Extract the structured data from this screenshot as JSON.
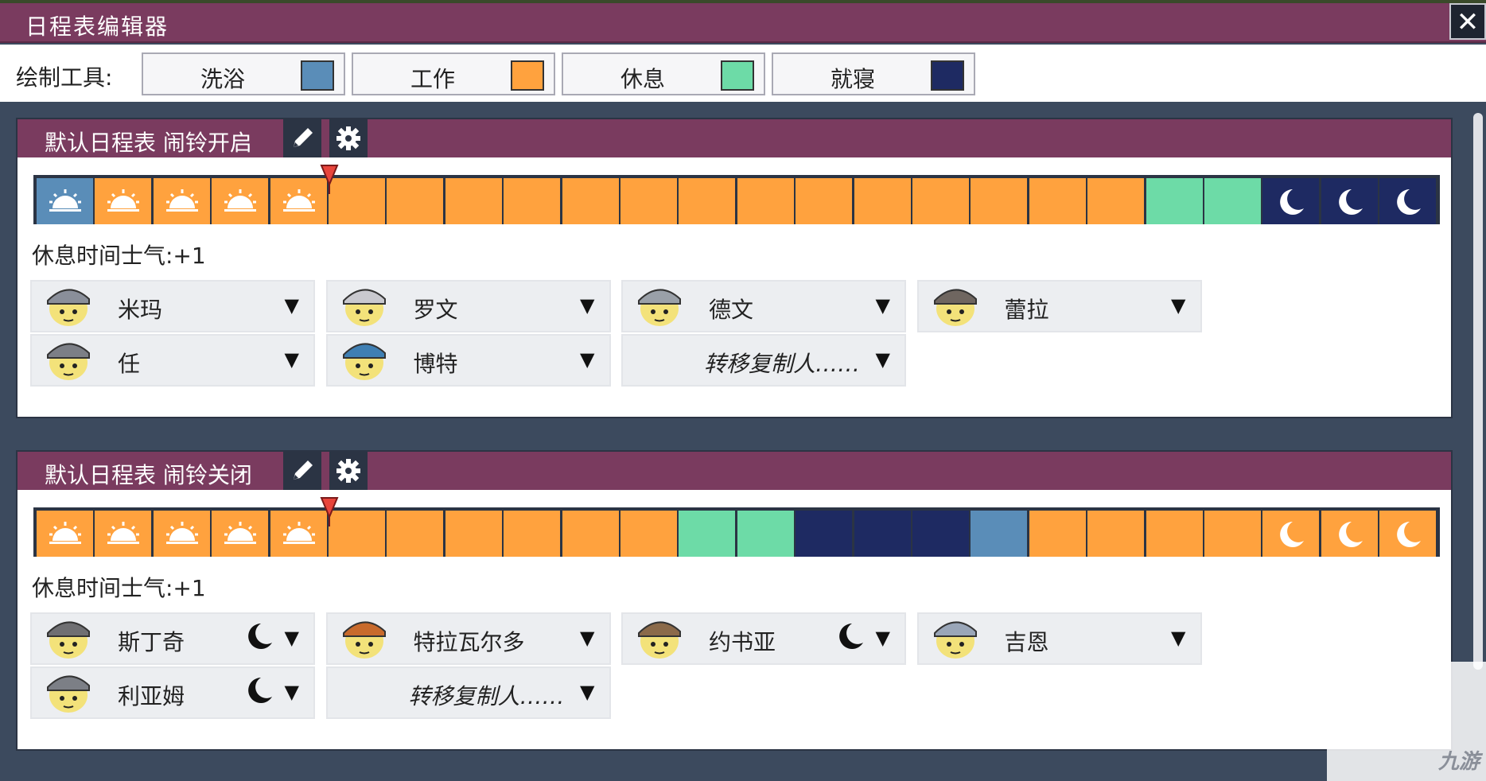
{
  "window": {
    "title": "日程表编辑器",
    "close": "✕"
  },
  "toolbar": {
    "label": "绘制工具:",
    "tools": [
      {
        "label": "洗浴",
        "color": "#5a8db8"
      },
      {
        "label": "工作",
        "color": "#ffa23e"
      },
      {
        "label": "休息",
        "color": "#6ddba7"
      },
      {
        "label": "就寝",
        "color": "#1e2a62"
      }
    ]
  },
  "schedules": [
    {
      "title": "默认日程表  闹铃开启",
      "edit_icon": "pencil-icon",
      "settings_icon": "gear-icon",
      "blocks": [
        "bath",
        "work",
        "work",
        "work",
        "work",
        "work",
        "work",
        "work",
        "work",
        "work",
        "work",
        "work",
        "work",
        "work",
        "work",
        "work",
        "work",
        "work",
        "work",
        "rest",
        "rest",
        "sleep",
        "sleep",
        "sleep"
      ],
      "block_icons": [
        "sun",
        "sun",
        "sun",
        "sun",
        "sun",
        "",
        "",
        "",
        "",
        "",
        "",
        "",
        "",
        "",
        "",
        "",
        "",
        "",
        "",
        "",
        "",
        "moon",
        "moon",
        "moon"
      ],
      "morale": "休息时间士气:+1",
      "dupes": [
        {
          "name": "米玛",
          "icon": "arrow-down",
          "moon": false
        },
        {
          "name": "罗文",
          "icon": "arrow-down",
          "moon": false
        },
        {
          "name": "德文",
          "icon": "arrow-down",
          "moon": false
        },
        {
          "name": "蕾拉",
          "icon": "arrow-down",
          "moon": false
        },
        {
          "name": "任",
          "icon": "arrow-down",
          "moon": false
        },
        {
          "name": "博特",
          "icon": "arrow-down",
          "moon": false
        }
      ],
      "transfer": "转移复制人……"
    },
    {
      "title": "默认日程表  闹铃关闭",
      "edit_icon": "pencil-icon",
      "settings_icon": "gear-icon",
      "blocks": [
        "work",
        "work",
        "work",
        "work",
        "work",
        "work",
        "work",
        "work",
        "work",
        "work",
        "work",
        "rest",
        "rest",
        "sleep",
        "sleep",
        "sleep",
        "bath",
        "work",
        "work",
        "work",
        "work",
        "work",
        "work",
        "work"
      ],
      "block_icons": [
        "sun",
        "sun",
        "sun",
        "sun",
        "sun",
        "",
        "",
        "",
        "",
        "",
        "",
        "",
        "",
        "",
        "",
        "",
        "",
        "",
        "",
        "",
        "",
        "moon",
        "moon",
        "moon"
      ],
      "morale": "休息时间士气:+1",
      "dupes": [
        {
          "name": "斯丁奇",
          "icon": "arrow-down",
          "moon": true
        },
        {
          "name": "特拉瓦尔多",
          "icon": "arrow-down",
          "moon": false
        },
        {
          "name": "约书亚",
          "icon": "arrow-down",
          "moon": true
        },
        {
          "name": "吉恩",
          "icon": "arrow-down",
          "moon": false
        },
        {
          "name": "利亚姆",
          "icon": "arrow-down",
          "moon": true
        }
      ],
      "transfer": "转移复制人……"
    }
  ],
  "watermark": "九游"
}
